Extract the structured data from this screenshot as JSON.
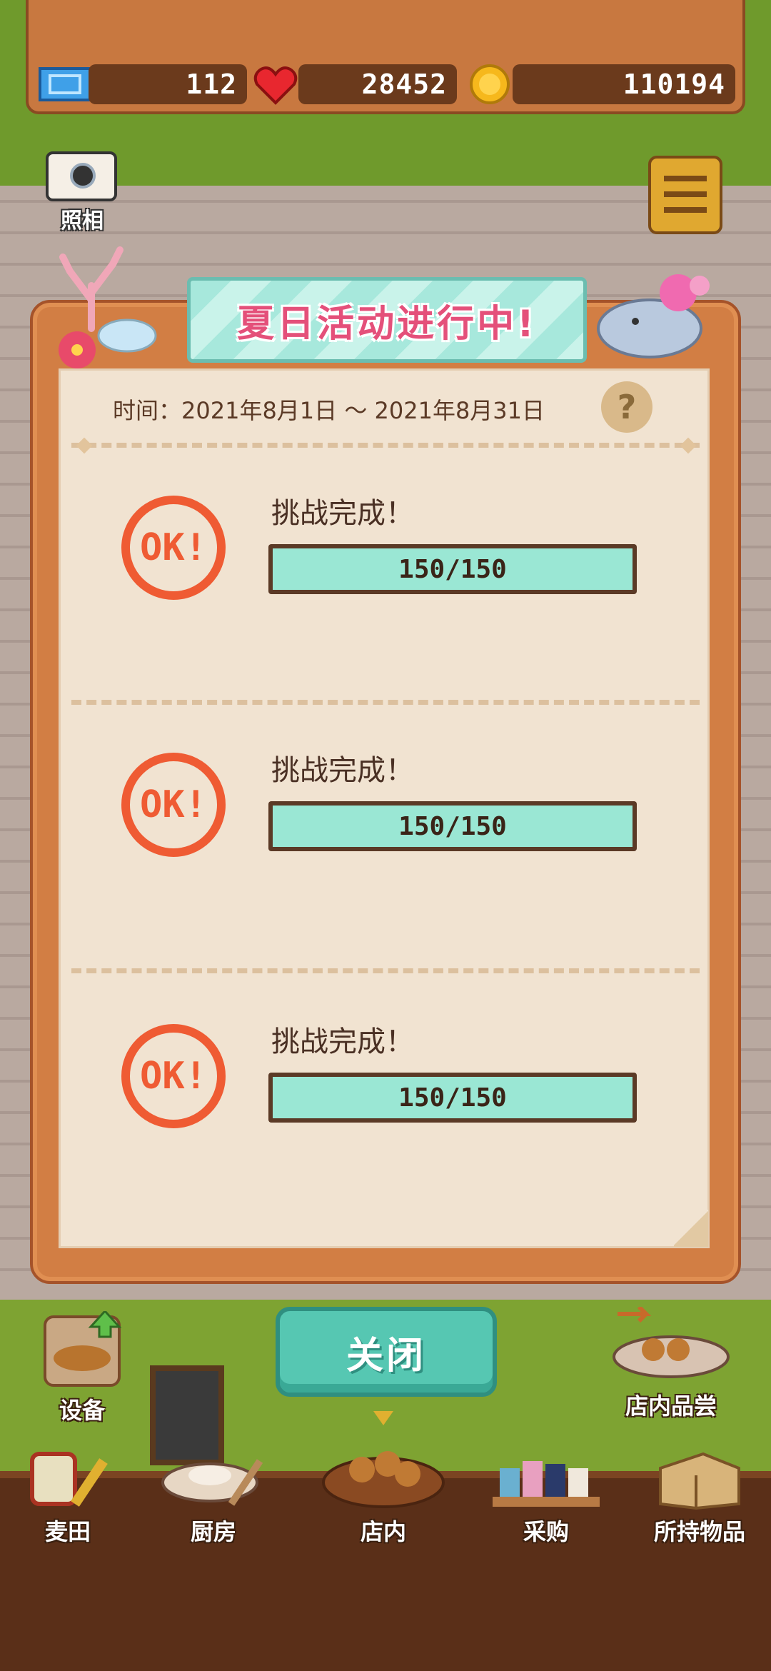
{
  "resources": {
    "tickets": "112",
    "hearts": "28452",
    "coins": "110194"
  },
  "widgets": {
    "camera_label": "照相"
  },
  "dialog": {
    "title": "夏日活动进行中!",
    "period": "时间：2021年8月1日 ～ 2021年8月31日",
    "help": "?",
    "challenges": [
      {
        "stamp": "OK!",
        "title": "挑战完成！",
        "progress": "150/150",
        "current": 150,
        "target": 150
      },
      {
        "stamp": "OK!",
        "title": "挑战完成！",
        "progress": "150/150",
        "current": 150,
        "target": 150
      },
      {
        "stamp": "OK!",
        "title": "挑战完成！",
        "progress": "150/150",
        "current": 150,
        "target": 150
      }
    ],
    "close_label": "关闭"
  },
  "nav": {
    "equipment": "设备",
    "tasting": "店内品尝",
    "field": "麦田",
    "kitchen": "厨房",
    "store": "店内",
    "purchase": "采购",
    "inventory": "所持物品"
  },
  "colors": {
    "stamp": "#ef5b33",
    "progress_fill": "#9ae7d4",
    "banner_text": "#e4507a",
    "close_button": "#56c7b2"
  },
  "icons": {
    "tickets": "ticket-icon",
    "hearts": "heart-icon",
    "coins": "coin-icon",
    "camera": "camera-icon",
    "menu": "menu-icon",
    "help": "question-icon"
  }
}
